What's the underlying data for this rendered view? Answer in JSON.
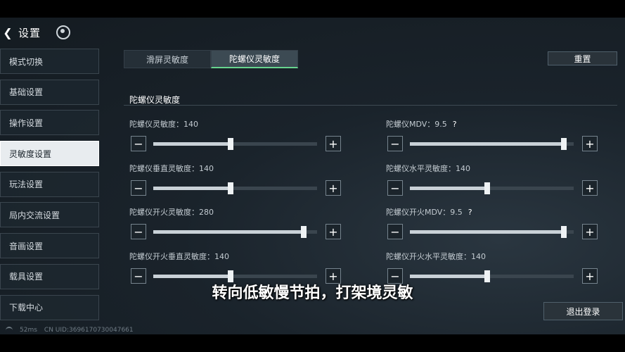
{
  "header": {
    "back_icon": "chevron-left-icon",
    "title": "设置",
    "logo_icon": "game-logo-icon"
  },
  "sidebar": {
    "items": [
      {
        "label": "模式切换"
      },
      {
        "label": "基础设置"
      },
      {
        "label": "操作设置"
      },
      {
        "label": "灵敏度设置",
        "active": true
      },
      {
        "label": "玩法设置"
      },
      {
        "label": "局内交流设置"
      },
      {
        "label": "音画设置"
      },
      {
        "label": "载具设置"
      },
      {
        "label": "下载中心"
      }
    ]
  },
  "tabs": [
    {
      "label": "滑屏灵敏度"
    },
    {
      "label": "陀螺仪灵敏度",
      "active": true
    }
  ],
  "reset_label": "重置",
  "section_title": "陀螺仪灵敏度",
  "settings": [
    {
      "label": "陀螺仪灵敏度：140",
      "level": 0.47
    },
    {
      "label": "陀螺仪MDV：9.5",
      "help": "?",
      "level": 0.94
    },
    {
      "label": "陀螺仪垂直灵敏度：140",
      "level": 0.47
    },
    {
      "label": "陀螺仪水平灵敏度：140",
      "level": 0.47
    },
    {
      "label": "陀螺仪开火灵敏度：280",
      "level": 0.92
    },
    {
      "label": "陀螺仪开火MDV：9.5",
      "help": "?",
      "level": 0.94
    },
    {
      "label": "陀螺仪开火垂直灵敏度：140",
      "level": 0.47
    },
    {
      "label": "陀螺仪开火水平灵敏度：140",
      "level": 0.47
    }
  ],
  "minus_label": "−",
  "plus_label": "+",
  "logout_label": "退出登录",
  "status": {
    "ping": "52ms",
    "uid": "CN UID:3696170730047661"
  },
  "subtitle": "转向低敏慢节拍，打架境灵敏"
}
